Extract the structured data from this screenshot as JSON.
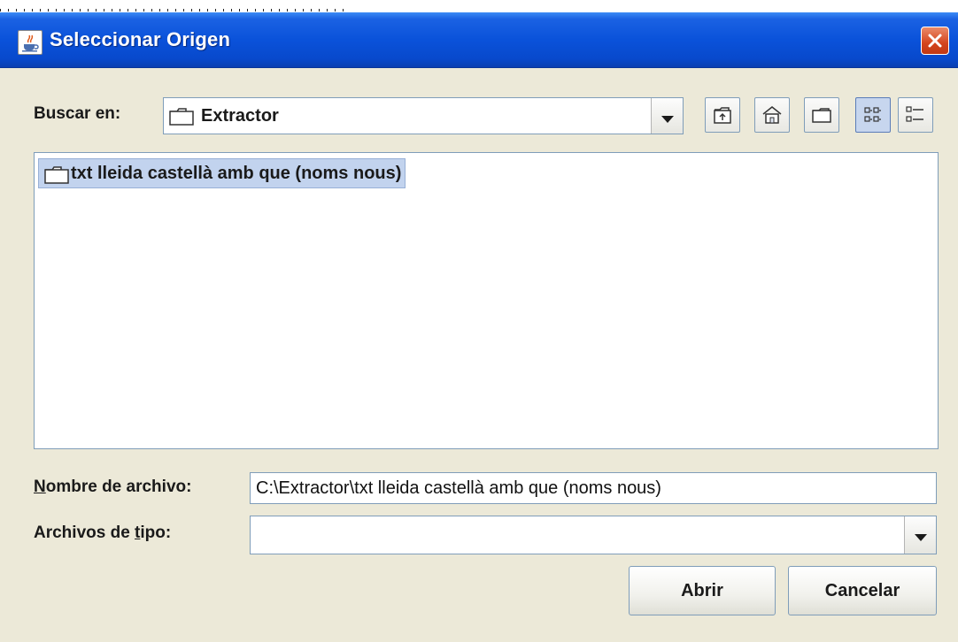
{
  "window": {
    "title": "Seleccionar Origen",
    "title_icon": "java-cup-icon",
    "close_icon": "close-icon"
  },
  "look_in": {
    "label": "Buscar en:",
    "value": "Extractor",
    "icon": "folder-icon"
  },
  "toolbar": {
    "buttons": [
      "up-folder-icon",
      "home-icon",
      "new-folder-icon",
      "list-view-icon",
      "details-view-icon"
    ],
    "selected": "list-view-icon"
  },
  "file_list": {
    "items": [
      {
        "name": "txt lleida castellà amb que (noms nous)",
        "icon": "folder-icon",
        "selected": true
      }
    ]
  },
  "filename": {
    "label_mnemonic": "N",
    "label_rest": "ombre de archivo:",
    "value": "C:\\Extractor\\txt lleida castellà amb que (noms nous)"
  },
  "filetype": {
    "label_pre": "Archivos de ",
    "label_mnemonic": "t",
    "label_post": "ipo:",
    "value": ""
  },
  "buttons": {
    "open": "Abrir",
    "cancel": "Cancelar"
  },
  "colors": {
    "titlebar": "#0a52da",
    "dialog_bg": "#ece9d8",
    "selection": "#c2d3ee",
    "close_red": "#d4451e"
  }
}
